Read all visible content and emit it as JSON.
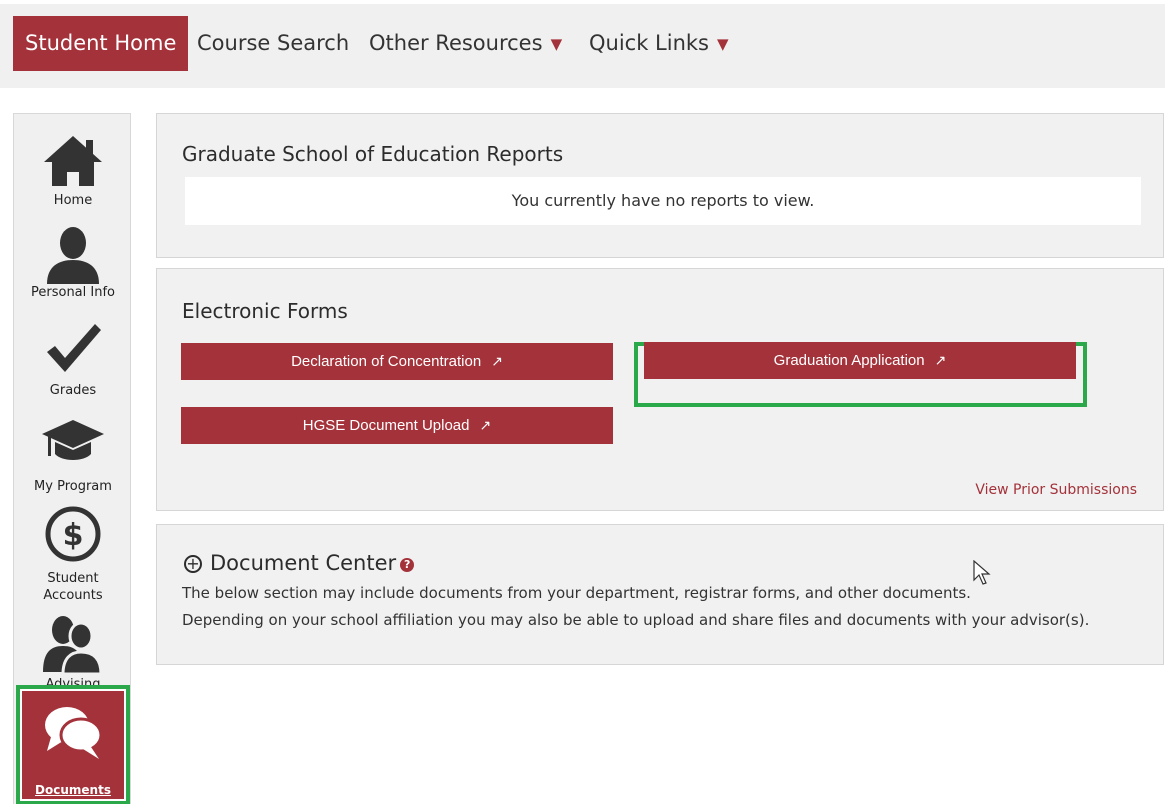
{
  "topnav": {
    "items": [
      {
        "label": "Student Home",
        "active": true
      },
      {
        "label": "Course Search"
      },
      {
        "label": "Other Resources"
      },
      {
        "label": "Quick Links"
      }
    ],
    "caret": "▼"
  },
  "sidebar": {
    "items": [
      {
        "label": "Home",
        "icon": "home-icon"
      },
      {
        "label": "Personal Info",
        "icon": "person-icon"
      },
      {
        "label": "Grades",
        "icon": "checkmark-icon"
      },
      {
        "label": "My Program",
        "icon": "graduation-cap-icon"
      },
      {
        "label": "Student Accounts",
        "label_line1": "Student",
        "label_line2": "Accounts",
        "icon": "dollar-icon"
      },
      {
        "label": "Advising",
        "icon": "people-icon"
      },
      {
        "label": "Documents",
        "icon": "chat-bubbles-icon"
      }
    ]
  },
  "reports": {
    "title": "Graduate School of Education Reports",
    "empty_message": "You currently have no reports to view."
  },
  "forms": {
    "title": "Electronic Forms",
    "buttons": [
      {
        "label": "Declaration of Concentration"
      },
      {
        "label": "Graduation Application"
      },
      {
        "label": "HGSE Document Upload"
      }
    ],
    "external_icon": "external-link-icon",
    "prior_link": "View Prior Submissions"
  },
  "document_center": {
    "title": "Document Center",
    "line1": "The below section may include documents from your department, registrar forms, and other documents.",
    "line2": "Depending on your school affiliation you may also be able to upload and share files and documents with your advisor(s)."
  },
  "colors": {
    "brand": "#a4323a",
    "highlight": "#2aa84a",
    "panel_bg": "#f1f1f1"
  }
}
